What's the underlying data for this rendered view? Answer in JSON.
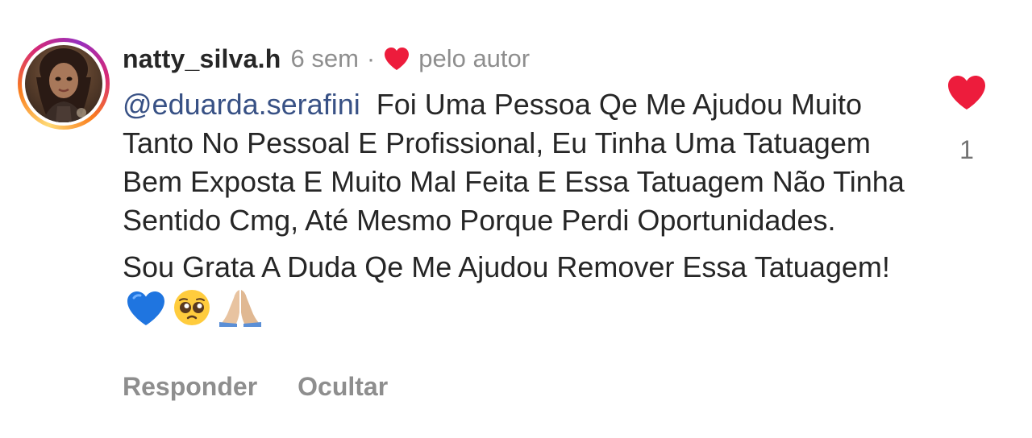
{
  "comment": {
    "username": "natty_silva.h",
    "time": "6 sem",
    "separator": "·",
    "liked_by_author_label": "pelo autor",
    "mention": "@eduarda.serafini",
    "paragraph1": "Foi Uma Pessoa Qe Me Ajudou Muito Tanto No Pessoal E Profissional, Eu Tinha Uma Tatuagem Bem Exposta E Muito Mal Feita E Essa Tatuagem Não Tinha Sentido Cmg, Até Mesmo Porque Perdi Oportunidades.",
    "paragraph2": "Sou Grata A Duda Qe Me Ajudou Remover Essa Tatuagem!",
    "emojis": [
      "blue-heart-icon",
      "pleading-face-icon",
      "folded-hands-icon"
    ],
    "like_count": "1"
  },
  "actions": {
    "reply_label": "Responder",
    "hide_label": "Ocultar"
  },
  "colors": {
    "heart": "#ed1c3c",
    "mention": "#385185",
    "text": "#262626",
    "muted": "#8e8e8e"
  }
}
